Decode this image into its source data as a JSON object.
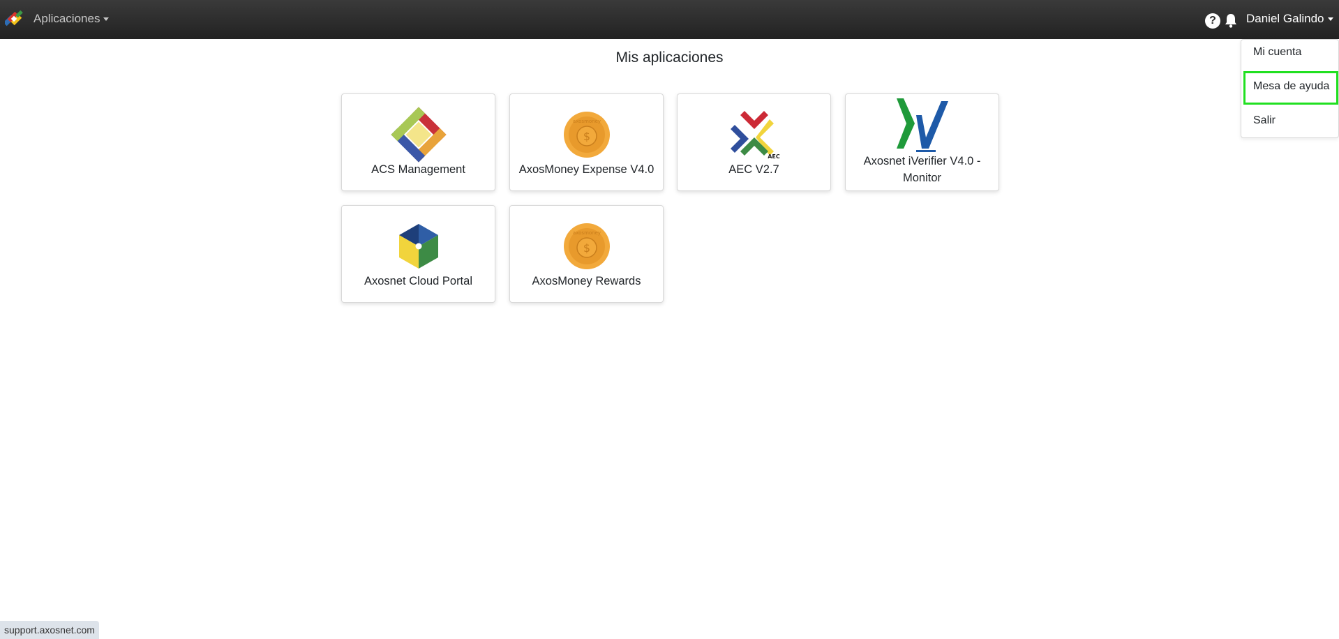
{
  "navbar": {
    "brand_icon": "axosnet-logo",
    "apps_menu_label": "Aplicaciones",
    "help_icon": "question-circle-icon",
    "help_glyph": "?",
    "notification_icon": "bell-icon",
    "user_name": "Daniel Galindo"
  },
  "user_dropdown": {
    "items": [
      {
        "label": "Mi cuenta"
      },
      {
        "label": "Mesa de ayuda",
        "highlighted": true,
        "highlight_color": "#20e020"
      },
      {
        "label": "Salir"
      }
    ]
  },
  "main": {
    "title": "Mis aplicaciones",
    "apps": [
      {
        "name": "ACS Management",
        "icon": "acs-diamond-logo"
      },
      {
        "name": "AxosMoney Expense V4.0",
        "icon": "axosmoney-coin-logo"
      },
      {
        "name": "AEC V2.7",
        "icon": "aec-arrows-logo",
        "icon_text": "AEC"
      },
      {
        "name": "Axosnet iVerifier V4.0 - Monitor",
        "icon": "iverifier-check-logo"
      },
      {
        "name": "Axosnet Cloud Portal",
        "icon": "cloud-portal-cube-logo"
      },
      {
        "name": "AxosMoney Rewards",
        "icon": "axosmoney-coin-logo"
      }
    ],
    "coin_text": "axosmoney",
    "coin_symbol": "$"
  },
  "status_bar": {
    "url": "support.axosnet.com"
  },
  "colors": {
    "navbar": "#2b2b2b",
    "highlight": "#20e020",
    "coin": "#f2a93b"
  }
}
